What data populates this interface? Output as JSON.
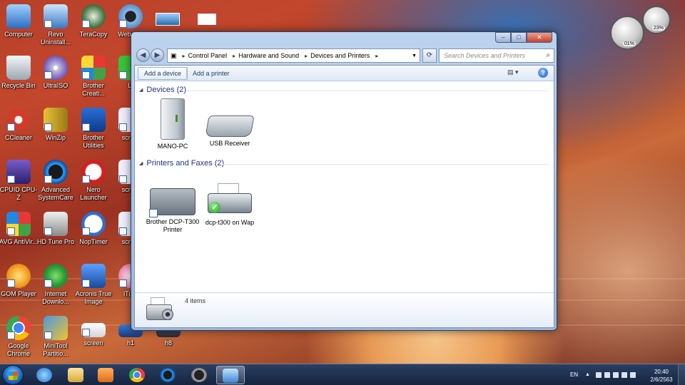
{
  "desktop": {
    "icons": [
      {
        "label": "Computer"
      },
      {
        "label": "Revo Uninstall..."
      },
      {
        "label": "TeraCopy"
      },
      {
        "label": "Webca..."
      },
      {
        "label": "Recycle Bin"
      },
      {
        "label": "UltraISO"
      },
      {
        "label": "Brother Creati..."
      },
      {
        "label": "LI"
      },
      {
        "label": "CCleaner"
      },
      {
        "label": "WinZip"
      },
      {
        "label": "Brother Utilities"
      },
      {
        "label": "scre..."
      },
      {
        "label": "CPUID CPU-Z"
      },
      {
        "label": "Advanced SystemCare"
      },
      {
        "label": "Nero Launcher"
      },
      {
        "label": "scre..."
      },
      {
        "label": "AVG AntiVir..."
      },
      {
        "label": "HD Tune Pro"
      },
      {
        "label": "NopTimer"
      },
      {
        "label": "scre..."
      },
      {
        "label": "GOM Player"
      },
      {
        "label": "Internet Downlo..."
      },
      {
        "label": "Acronis True Image"
      },
      {
        "label": "iTu..."
      },
      {
        "label": "Google Chrome"
      },
      {
        "label": "MiniTool Partitio..."
      },
      {
        "label": "screen"
      },
      {
        "label": "h1"
      },
      {
        "label": "h8"
      }
    ]
  },
  "gadgets": {
    "cpu_meter_value": "01%",
    "ram_meter_value": "23%"
  },
  "window": {
    "breadcrumb": [
      "Control Panel",
      "Hardware and Sound",
      "Devices and Printers"
    ],
    "search_placeholder": "Search Devices and Printers",
    "toolbar": {
      "add_device": "Add a device",
      "add_printer": "Add a printer"
    },
    "groups": {
      "devices": {
        "title": "Devices (2)",
        "items": [
          {
            "label": "MANO-PC",
            "icon": "computer-tower-icon"
          },
          {
            "label": "USB Receiver",
            "icon": "keyboard-icon"
          }
        ]
      },
      "printers": {
        "title": "Printers and Faxes (2)",
        "items": [
          {
            "label": "Brother DCP-T300 Printer",
            "icon": "printer-icon"
          },
          {
            "label": "dcp-t300 on Wap",
            "icon": "printer-icon",
            "default": true
          }
        ]
      }
    },
    "details": {
      "count": "4 items"
    }
  },
  "taskbar": {
    "apps": [
      "start-orb",
      "internet-explorer",
      "windows-explorer",
      "media-player",
      "google-chrome",
      "advanced-systemcare",
      "speed-gauge",
      "devices-and-printers"
    ],
    "language": "EN",
    "time": "20:40",
    "date": "2/6/2563"
  }
}
